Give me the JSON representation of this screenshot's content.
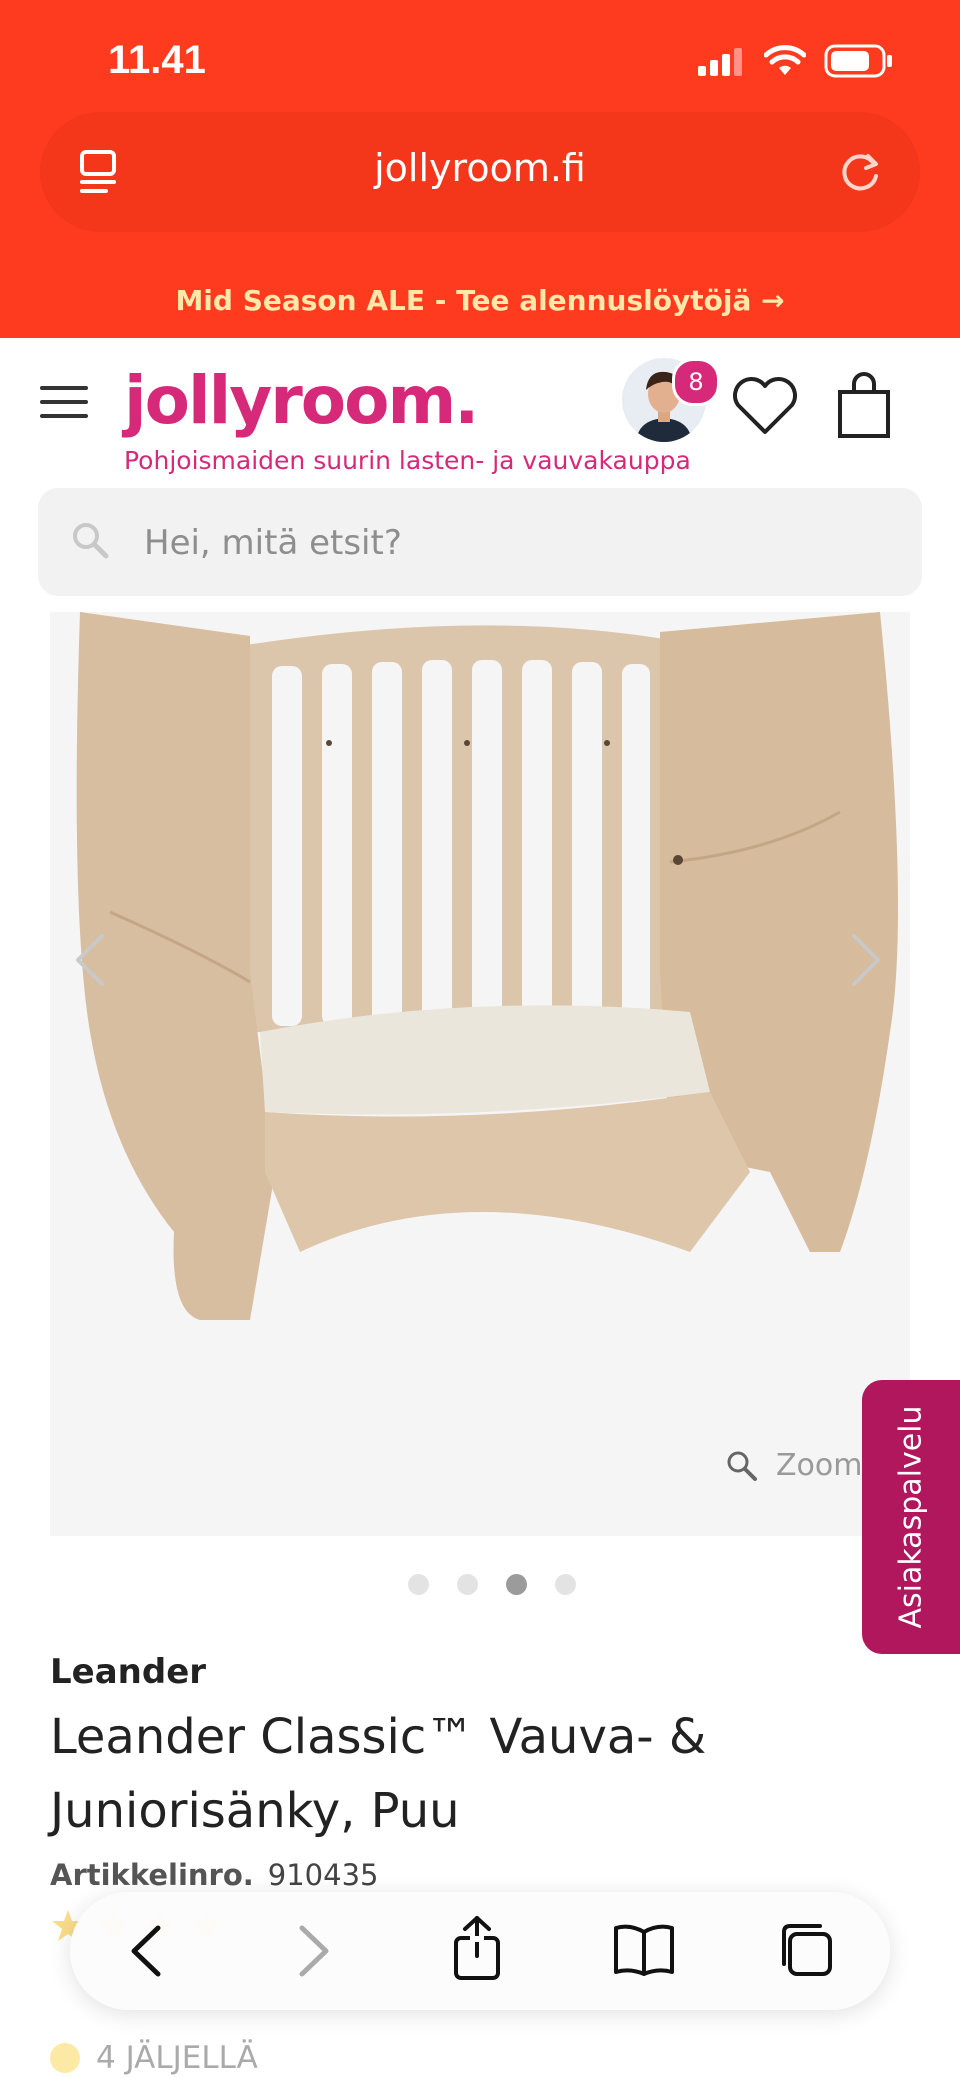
{
  "status_bar": {
    "time": "11.41"
  },
  "browser": {
    "url": "jollyroom.fi"
  },
  "promo_banner": {
    "text": "Mid Season ALE - Tee alennuslöytöjä →"
  },
  "header": {
    "logo": "jollyroom.",
    "tagline": "Pohjoismaiden suurin lasten- ja vauvakauppa",
    "avatar_badge": "8"
  },
  "search": {
    "placeholder": "Hei, mitä etsit?"
  },
  "gallery": {
    "zoom_label": "Zoom",
    "slide_count": 4,
    "active_slide": 3
  },
  "support_tab": {
    "label": "Asiakaspalvelu"
  },
  "product": {
    "brand": "Leander",
    "title": "Leander Classic™ Vauva- & Juniorisänky, Puu",
    "article_label": "Artikkelinro.",
    "article_number": "910435",
    "stock": "4 JÄLJELLÄ"
  },
  "colors": {
    "topbar": "#ff3b1f",
    "brand_pink": "#d6297a",
    "support_tab": "#b0175c",
    "promo_text": "#ffe8a8"
  },
  "icons": [
    "wifi-icon",
    "battery-icon",
    "signal-icon",
    "reader-icon",
    "reload-icon",
    "hamburger-icon",
    "heart-icon",
    "bag-icon",
    "search-icon",
    "zoom-icon",
    "back-icon",
    "forward-icon",
    "share-icon",
    "bookmarks-icon",
    "tabs-icon",
    "star-icon"
  ]
}
